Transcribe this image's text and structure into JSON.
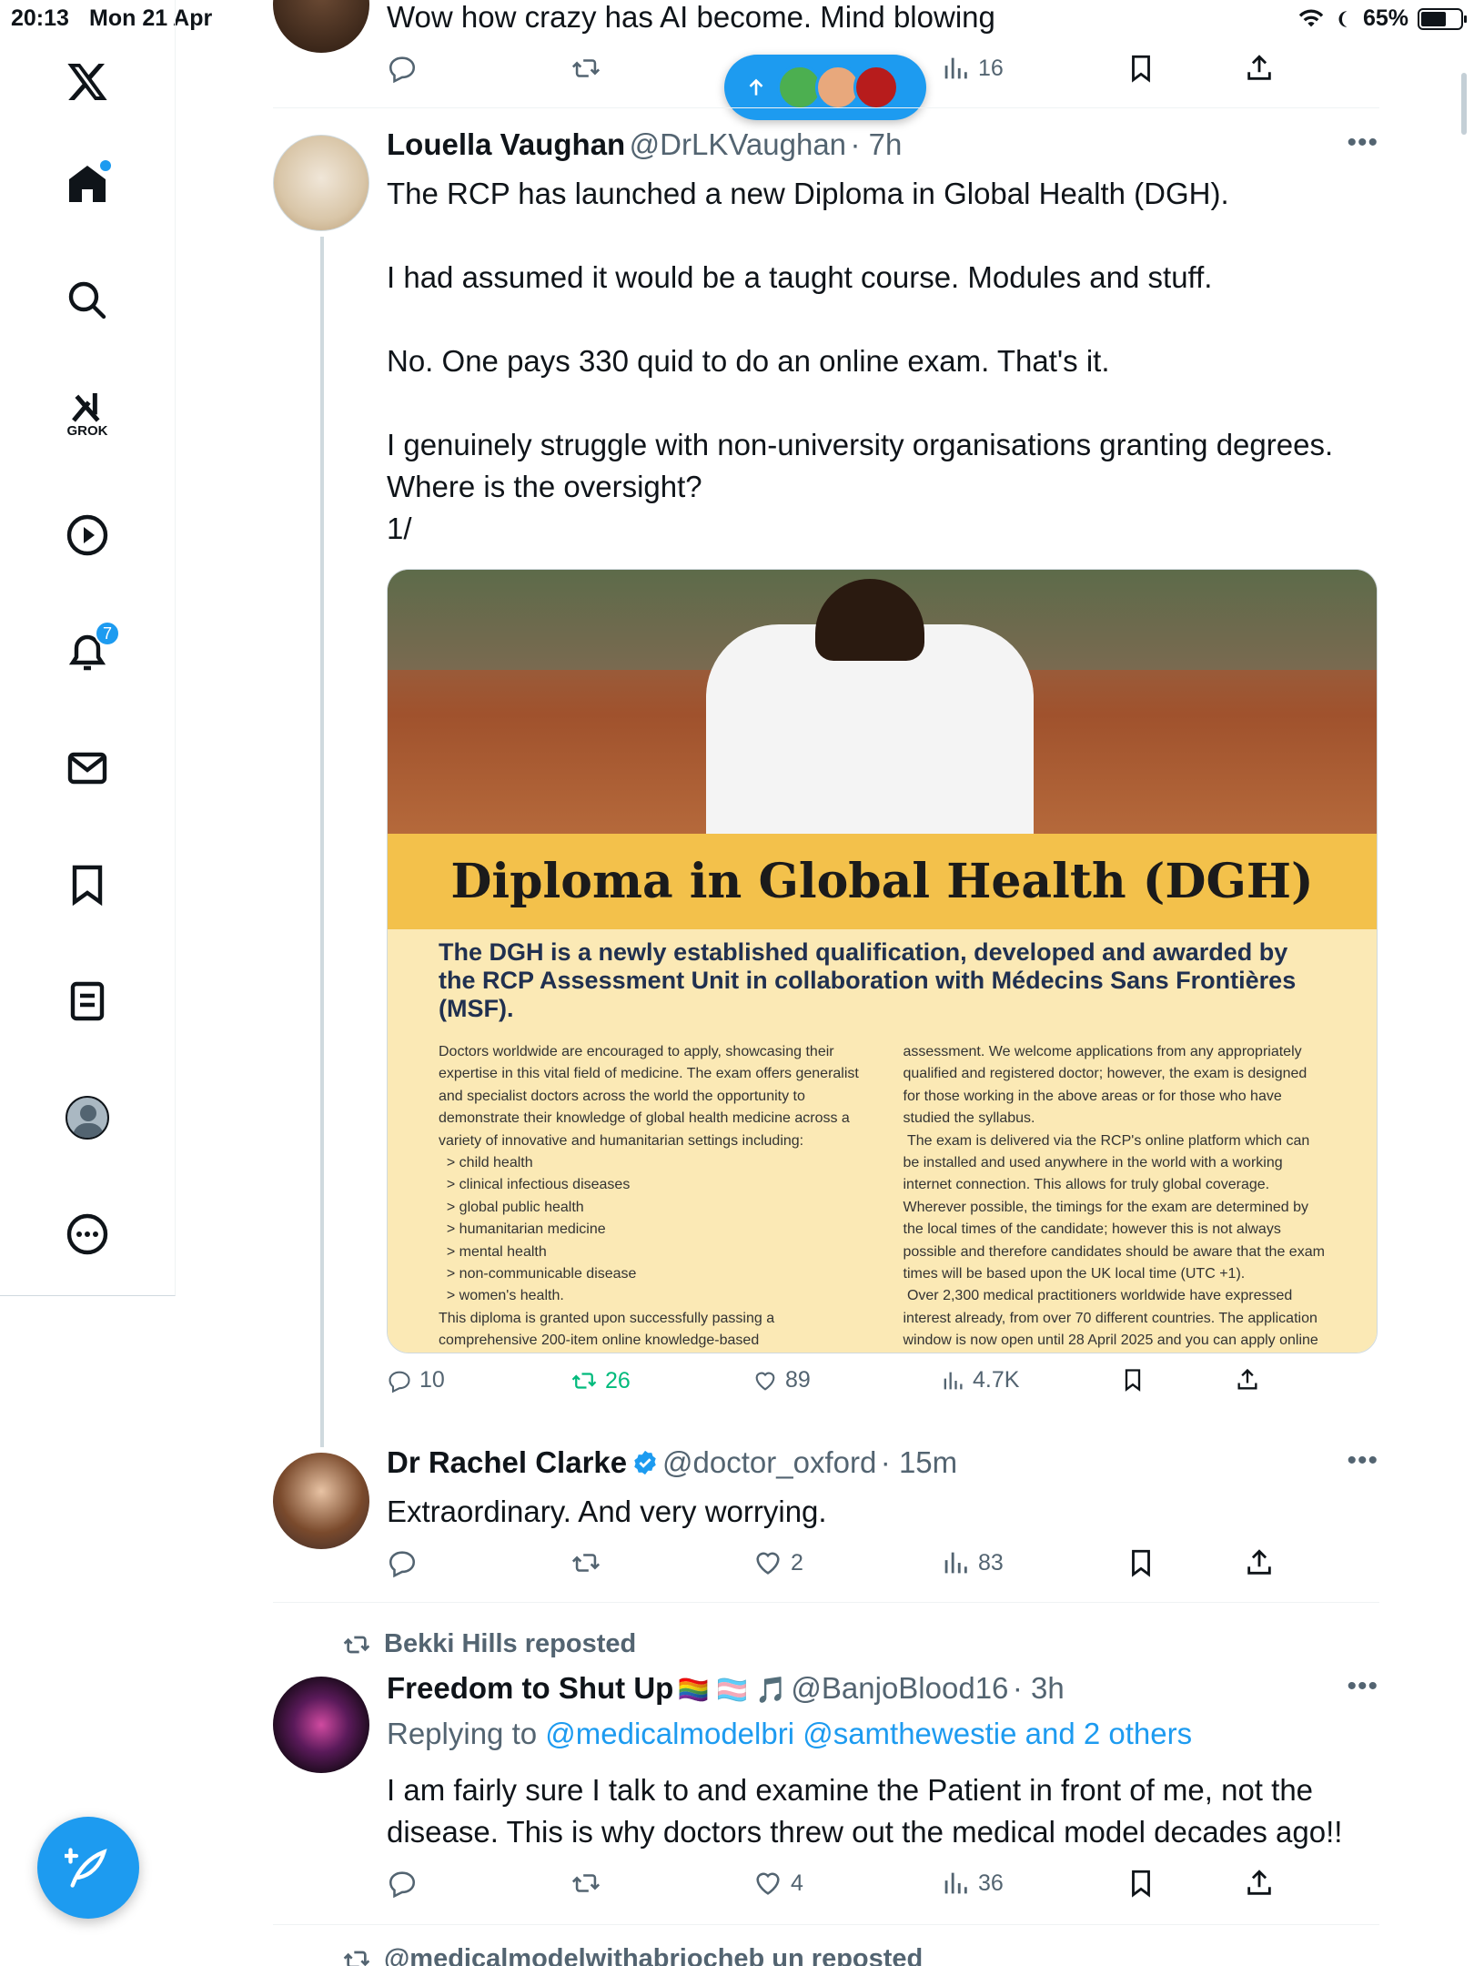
{
  "status": {
    "time": "20:13",
    "date": "Mon 21 Apr",
    "battery": "65%"
  },
  "nav": {
    "items": [
      "x-logo",
      "home",
      "search",
      "grok",
      "videos",
      "notifications",
      "messages",
      "bookmarks",
      "lists",
      "profile",
      "more"
    ],
    "grok_label": "GROK",
    "notifications_badge": "7"
  },
  "prev_tweet": {
    "text": "Wow how crazy has AI become. Mind blowing",
    "views": "16"
  },
  "tweet1": {
    "name": "Louella Vaughan",
    "handle": "@DrLKVaughan",
    "time": "· 7h",
    "text": "The RCP has launched a new Diploma in Global Health (DGH).\n\nI had assumed it would be a taught course. Modules and stuff.\n\nNo. One pays 330 quid to do an online exam. That's it.\n\nI genuinely struggle with non-university organisations granting degrees. Where is the oversight?\n1/",
    "replies": "10",
    "reposts": "26",
    "likes": "89",
    "views": "4.7K",
    "card": {
      "title": "Diploma in Global Health (DGH)",
      "lead": "The DGH is a newly established qualification, developed and awarded by the RCP Assessment Unit in collaboration with Médecins Sans Frontières (MSF).",
      "col1": "Doctors worldwide are encouraged to apply, showcasing their expertise in this vital field of medicine. The exam offers generalist and specialist doctors across the world the opportunity to demonstrate their knowledge of global health medicine across a variety of innovative and humanitarian settings including:\n  > child health\n  > clinical infectious diseases\n  > global public health\n  > humanitarian medicine\n  > mental health\n  > non-communicable disease\n  > women's health.\nThis diploma is granted upon successfully passing a comprehensive 200-item online knowledge-based",
      "col2": "assessment. We welcome applications from any appropriately qualified and registered doctor; however, the exam is designed for those working in the above areas or for those who have studied the syllabus.\n The exam is delivered via the RCP's online platform which can be installed and used anywhere in the world with a working internet connection. This allows for truly global coverage. Wherever possible, the timings for the exam are determined by the local times of the candidate; however this is not always possible and therefore candidates should be aware that the exam times will be based upon the UK local time (UTC +1).\n Over 2,300 medical practitioners worldwide have expressed interest already, from over 70 different countries. The application window is now open until 28 April 2025 and you can apply online today."
    }
  },
  "tweet2": {
    "name": "Dr Rachel Clarke",
    "handle": "@doctor_oxford",
    "time": "· 15m",
    "text": "Extraordinary. And very worrying.",
    "likes": "2",
    "views": "83"
  },
  "tweet3": {
    "repost_label": "Bekki Hills reposted",
    "name": "Freedom to Shut Up",
    "name_emoji": "🏳️‍🌈 🏳️‍⚧️ 🎵",
    "handle": "@BanjoBlood16",
    "time": "· 3h",
    "replying_prefix": "Replying to ",
    "replying_to": "@medicalmodelbri @samthewestie and 2 others",
    "text": "I am fairly sure I talk to and examine the Patient in front of me, not the disease. This is why doctors threw out the medical model decades ago!!",
    "likes": "4",
    "views": "36"
  },
  "next_repost_label": "@medicalmodelwithabriocheb un reposted",
  "colors": {
    "accent": "#1d9bf0",
    "repost_green": "#00ba7c",
    "muted": "#536471"
  }
}
